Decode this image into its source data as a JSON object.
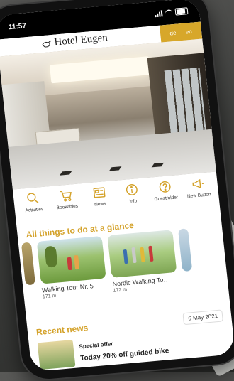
{
  "status": {
    "time": "11:57"
  },
  "header": {
    "brand": "Hotel Eugen",
    "languages": [
      "de",
      "en"
    ]
  },
  "nav": [
    {
      "label": "Activities",
      "icon": "search-icon"
    },
    {
      "label": "Bookables",
      "icon": "cart-icon"
    },
    {
      "label": "News",
      "icon": "newspaper-icon"
    },
    {
      "label": "Info",
      "icon": "info-icon"
    },
    {
      "label": "Guestfolder",
      "icon": "help-icon"
    },
    {
      "label": "New Button",
      "icon": "megaphone-icon"
    }
  ],
  "things": {
    "title": "All things to do at a glance",
    "cards": [
      {
        "title": "Walking Tour Nr. 5",
        "distance": "171 m"
      },
      {
        "title": "Nordic Walking To...",
        "distance": "172 m"
      }
    ]
  },
  "news": {
    "title": "Recent news",
    "date": "6 May 2021",
    "item": {
      "kicker": "Special offer",
      "headline": "Today 20% off guided bike"
    }
  },
  "colors": {
    "accent": "#d4a22a"
  }
}
